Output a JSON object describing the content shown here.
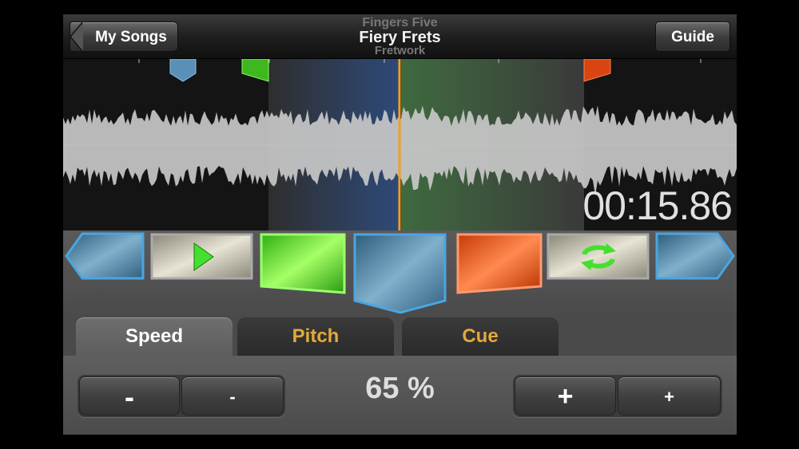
{
  "navbar": {
    "back_label": "My Songs",
    "artist": "Fingers Five",
    "song_title": "Fiery Frets",
    "album": "Fretwork",
    "guide_label": "Guide"
  },
  "waveform": {
    "time_display": "00:15.86"
  },
  "controls": {
    "buttons": [
      "skip-back",
      "play",
      "set-loop-start",
      "cue-marker",
      "set-loop-end",
      "toggle-loop",
      "skip-forward"
    ]
  },
  "tabs": [
    {
      "label": "Speed",
      "selected": true
    },
    {
      "label": "Pitch",
      "selected": false
    },
    {
      "label": "Cue",
      "selected": false
    }
  ],
  "speed": {
    "value": "65 %",
    "decrease_large_label": "-",
    "decrease_small_label": "-",
    "increase_large_label": "+",
    "increase_small_label": "+"
  },
  "colors": {
    "playhead": "#f0a020",
    "loop_start_marker": "#3fc01f",
    "loop_end_marker": "#e04a10",
    "cue_marker": "#5aa0c8",
    "tab_label_inactive": "#e3a93c"
  }
}
